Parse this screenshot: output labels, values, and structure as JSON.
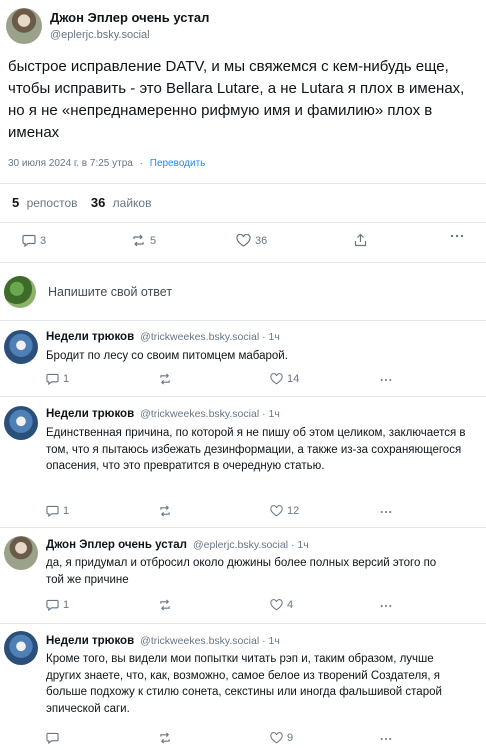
{
  "post": {
    "author_name": "Джон Эплер очень устал",
    "author_handle": "@eplerjc.bsky.social",
    "text": "быстрое исправление DATV, и мы свяжемся с кем-нибудь еще, чтобы исправить - это Bellara Lutare, а не Lutara я плох в именах, но я не «непреднамеренно рифмую имя и фамилию» плох в именах",
    "timestamp": "30 июля 2024 г. в 7:25 утра",
    "separator": "·",
    "translate_label": "Переводить",
    "reposts_count": "5",
    "reposts_label": "репостов",
    "likes_count": "36",
    "likes_label": "лайков",
    "actions": {
      "replies": "3",
      "reposts": "5",
      "likes": "36"
    }
  },
  "compose": {
    "placeholder": "Напишите свой ответ"
  },
  "replies": [
    {
      "name": "Недели трюков",
      "handle": "@trickweekes.bsky.social · 1ч",
      "text": "Бродит по лесу со своим питомцем мабарой.",
      "replies": "1",
      "reposts": "",
      "likes": "14"
    },
    {
      "name": "Недели трюков",
      "handle": "@trickweekes.bsky.social · 1ч",
      "text": "Единственная причина, по которой я не пишу об этом целиком, заключается в том, что я пытаюсь избежать дезинформации, а также из-за сохраняющегося опасения, что это превратится в очередную статью.",
      "replies": "1",
      "reposts": "",
      "likes": "12"
    },
    {
      "name": "Джон Эплер очень устал",
      "handle": "@eplerjc.bsky.social · 1ч",
      "text": "да, я придумал и отбросил около дюжины более полных версий этого по той же причине",
      "replies": "1",
      "reposts": "",
      "likes": "4"
    },
    {
      "name": "Недели трюков",
      "handle": "@trickweekes.bsky.social · 1ч",
      "text": "Кроме того, вы видели мои попытки читать рэп и, таким образом, лучше других знаете, что, как, возможно, самое белое из творений Создателя, я больше подхожу к стилю сонета, секстины или иногда фальшивой старой эпической саги.",
      "replies": "",
      "reposts": "",
      "likes": "9"
    }
  ]
}
